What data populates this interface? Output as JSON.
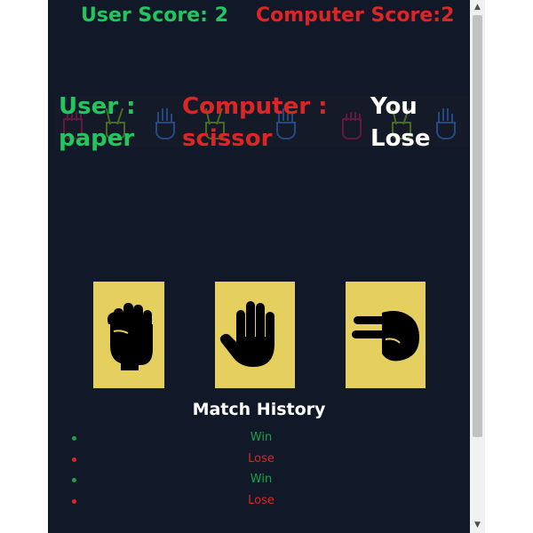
{
  "scores": {
    "user": "User Score: 2",
    "computer": "Computer Score:2"
  },
  "round": {
    "user_line1": "User :",
    "user_line2": "paper",
    "computer_line1": "Computer :",
    "computer_line2": "scissor",
    "result_line1": "You",
    "result_line2": "Lose"
  },
  "choices": [
    {
      "label": "rock",
      "icon": "fist-icon"
    },
    {
      "label": "paper",
      "icon": "open-hand-icon"
    },
    {
      "label": "scissor",
      "icon": "scissors-hand-icon"
    }
  ],
  "history": {
    "title": "Match History",
    "items": [
      "Win",
      "Lose",
      "Win",
      "Lose"
    ]
  },
  "colors": {
    "background": "#111827",
    "user": "#22c55e",
    "computer": "#dc2626",
    "card": "#e5cf5f"
  }
}
